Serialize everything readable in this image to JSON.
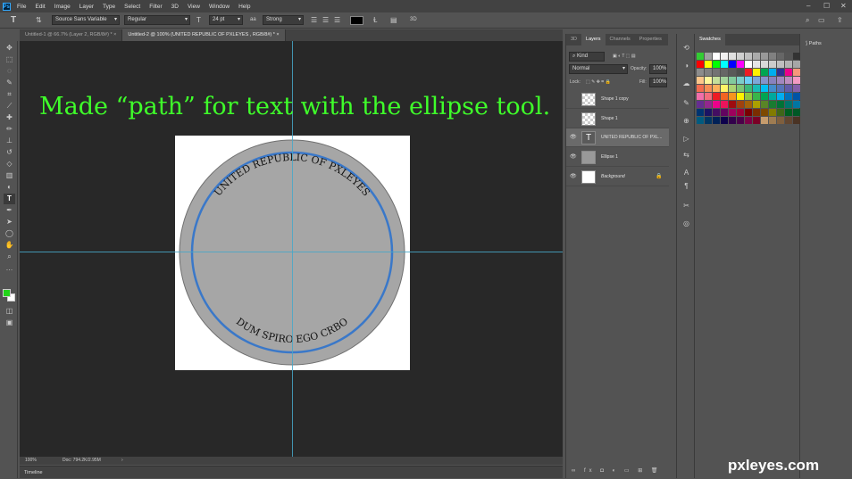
{
  "app": {
    "logo": "Ps"
  },
  "menu": [
    "File",
    "Edit",
    "Image",
    "Layer",
    "Type",
    "Select",
    "Filter",
    "3D",
    "View",
    "Window",
    "Help"
  ],
  "options": {
    "font_family": "Source Sans Variable",
    "font_style": "Regular",
    "font_size": "24 pt",
    "antialias_icon": "aa",
    "antialias": "Strong",
    "three_d": "3D"
  },
  "tabs": [
    {
      "label": "Untitled-1 @ 66.7% (Layer 2, RGB/8#) *"
    },
    {
      "label": "Untitled-2 @ 100% (UNITED REPUBLIC OF  PXLEYES                    , RGB/8#) *"
    }
  ],
  "canvas": {
    "note": "Made “path” for text with the ellipse tool.",
    "arc_top": "UNITED REPUBLIC OF PXLEYES",
    "arc_bottom": "DUM SPIRO EGO CRBO",
    "circle_fill": "#a6a6a6",
    "circle_stroke": "#707070",
    "path_color": "#3a78c9"
  },
  "status": {
    "zoom": "100%",
    "doc": "Doc: 794.2K/2.95M"
  },
  "timeline_label": "Timeline",
  "layers_panel": {
    "tabs": [
      "3D",
      "Layers",
      "Channels",
      "Properties"
    ],
    "kind": "Kind",
    "blend_mode": "Normal",
    "opacity_label": "Opacity:",
    "opacity_value": "100%",
    "lock_label": "Lock:",
    "fill_label": "Fill:",
    "fill_value": "100%",
    "layers": [
      {
        "name": "Shape 1 copy",
        "visible": false
      },
      {
        "name": "Shape 1",
        "visible": false
      },
      {
        "name": "UNITED REPUBLIC OF PXL...",
        "visible": true
      },
      {
        "name": "Ellipse 1",
        "visible": true
      },
      {
        "name": "Background",
        "visible": true
      }
    ]
  },
  "swatches_panel": {
    "title": "Swatches"
  },
  "paths_panel": {
    "title": "Paths"
  },
  "watermark": "pxleyes.com",
  "colors": {
    "foreground": "#22d41a",
    "background": "#ffffff",
    "guide": "#47a7c8",
    "note_text": "#3fff2a"
  },
  "swatch_colors": [
    "#33cc33",
    "#a0a0a0",
    "#ffffff",
    "#f2f2f2",
    "#e0e0e0",
    "#d0d0d0",
    "#c0c0c0",
    "#aaaaaa",
    "#999999",
    "#808080",
    "#666666",
    "#555555",
    "#333333",
    "#000000",
    "#ff0000",
    "#ffff00",
    "#00ff00",
    "#00ffff",
    "#0000ff",
    "#ff00ff",
    "#ffffff",
    "#e6e6e6",
    "#d9d9d9",
    "#cccccc",
    "#bfbfbf",
    "#b3b3b3",
    "#a6a6a6",
    "#999999",
    "#8c8c8c",
    "#808080",
    "#737373",
    "#666666",
    "#595959",
    "#4d4d4d",
    "#ed1c24",
    "#fff200",
    "#00a651",
    "#00aeef",
    "#2e3192",
    "#ec008c",
    "#f7977a",
    "#f9ad81",
    "#fdc68a",
    "#fff79a",
    "#c4df9b",
    "#a3d39c",
    "#82ca9d",
    "#7bcdc8",
    "#6ecff6",
    "#7ea7d8",
    "#8493ca",
    "#8882be",
    "#a187be",
    "#bc8dbf",
    "#f49ac2",
    "#f6989d",
    "#f26c4f",
    "#f68e55",
    "#fbaf5c",
    "#fff467",
    "#acd372",
    "#7cc576",
    "#3bb878",
    "#1abbb4",
    "#00bff3",
    "#438ccb",
    "#5574b9",
    "#605ca8",
    "#855fa8",
    "#a763a8",
    "#f06eaa",
    "#f26d7d",
    "#ed1c24",
    "#f26522",
    "#f7941d",
    "#fff200",
    "#8dc73f",
    "#39b54a",
    "#00a651",
    "#00a99d",
    "#00aeef",
    "#0072bc",
    "#0054a6",
    "#2e3192",
    "#662d91",
    "#92278f",
    "#ec008c",
    "#ed145b",
    "#9e0b0f",
    "#a0410d",
    "#a3620a",
    "#aba000",
    "#598527",
    "#197b30",
    "#007236",
    "#00746b",
    "#0076a3",
    "#004b80",
    "#003471",
    "#1b1464",
    "#440e62",
    "#630460",
    "#9e005d",
    "#9e0039",
    "#790000",
    "#7b2e00",
    "#7d4900",
    "#827b00",
    "#406618",
    "#005e20",
    "#005826",
    "#005952",
    "#005b7f",
    "#003663",
    "#002157",
    "#0d004c",
    "#32004b",
    "#4b0049",
    "#7b0046",
    "#7a0026",
    "#c69c6d",
    "#9e7c52",
    "#7f5f3e",
    "#624631",
    "#4a3324",
    "#372518"
  ]
}
